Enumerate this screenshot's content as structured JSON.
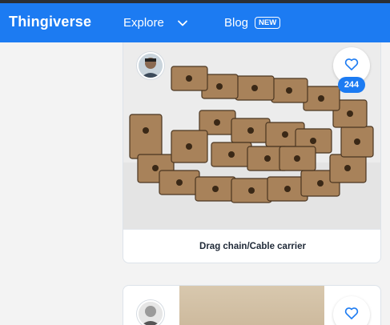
{
  "navbar": {
    "logo": "Thingiverse",
    "explore_label": "Explore",
    "blog_label": "Blog",
    "blog_badge": "NEW"
  },
  "cards": [
    {
      "title": "Drag chain/Cable carrier",
      "likes": "244"
    },
    {
      "title": "",
      "likes": ""
    }
  ],
  "colors": {
    "brand": "#1c7bf2",
    "background": "#f3f3f3",
    "card": "#ffffff"
  },
  "icons": {
    "explore_chevron": "chevron-down-icon",
    "like": "heart-outline-icon"
  }
}
